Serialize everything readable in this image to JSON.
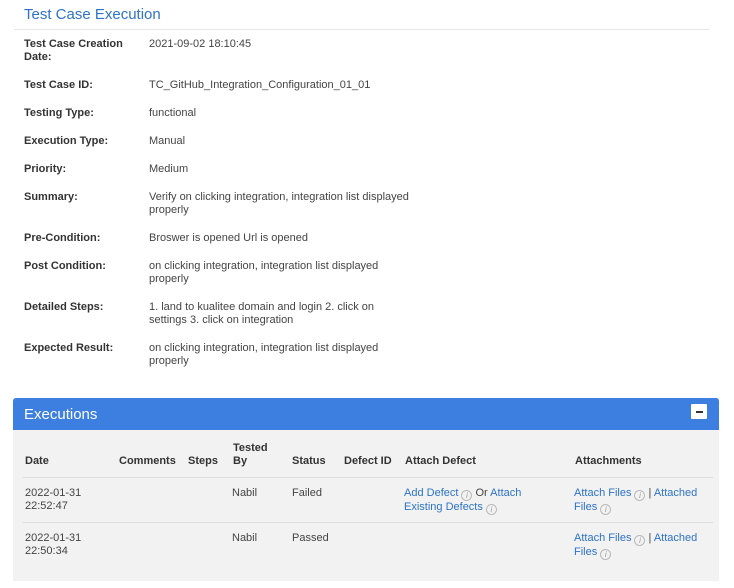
{
  "page": {
    "title": "Test Case Execution"
  },
  "details": [
    {
      "label": "Test Case Creation Date:",
      "value": "2021-09-02 18:10:45"
    },
    {
      "label": "Test Case ID:",
      "value": "TC_GitHub_Integration_Configuration_01_01"
    },
    {
      "label": "Testing Type:",
      "value": "functional"
    },
    {
      "label": "Execution Type:",
      "value": "Manual"
    },
    {
      "label": "Priority:",
      "value": "Medium"
    },
    {
      "label": "Summary:",
      "value": "Verify on clicking integration, integration list displayed properly"
    },
    {
      "label": "Pre-Condition:",
      "value": "Broswer is opened Url is opened"
    },
    {
      "label": "Post Condition:",
      "value": "on clicking integration, integration list displayed properly"
    },
    {
      "label": "Detailed Steps:",
      "value": "1. land to kualitee domain and login 2. click on settings 3. click on integration"
    },
    {
      "label": "Expected Result:",
      "value": "on clicking integration, integration list displayed properly"
    }
  ],
  "executions": {
    "title": "Executions",
    "collapse_icon": "minus-icon",
    "columns": {
      "date": "Date",
      "comments": "Comments",
      "steps": "Steps",
      "tested_by": "Tested By",
      "status": "Status",
      "defect_id": "Defect ID",
      "attach_defect": "Attach Defect",
      "attachments": "Attachments"
    },
    "rows": [
      {
        "date": "2022-01-31 22:52:47",
        "comments": "",
        "steps": "",
        "tested_by": "Nabil",
        "status": "Failed",
        "defect_id": "",
        "add_defect": "Add Defect",
        "or_text": "Or",
        "attach_existing": "Attach Existing Defects",
        "attach_files": "Attach Files",
        "separator": "|",
        "attached_files": "Attached Files"
      },
      {
        "date": "2022-01-31 22:50:34",
        "comments": "",
        "steps": "",
        "tested_by": "Nabil",
        "status": "Passed",
        "defect_id": "",
        "attach_files": "Attach Files",
        "separator": "|",
        "attached_files": "Attached Files"
      }
    ],
    "info_icon_glyph": "i"
  }
}
